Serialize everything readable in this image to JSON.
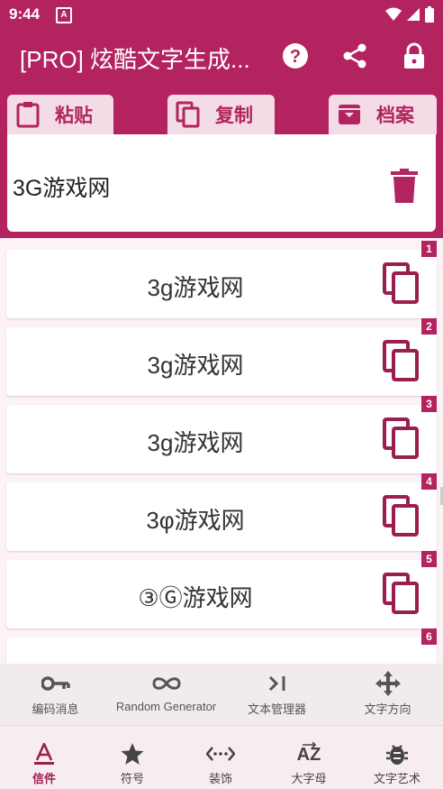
{
  "status": {
    "time": "9:44",
    "notif_letter": "A"
  },
  "appbar": {
    "title": "[PRO] 炫酷文字生成..."
  },
  "toolbar": {
    "paste_label": "粘贴",
    "copy_label": "复制",
    "archive_label": "档案"
  },
  "editor": {
    "text": "3G游戏网"
  },
  "results": [
    {
      "text": "3g游戏网",
      "num": "1"
    },
    {
      "text": "3g游戏网",
      "num": "2"
    },
    {
      "text": "3g游戏网",
      "num": "3"
    },
    {
      "text": "3φ游戏网",
      "num": "4"
    },
    {
      "text": "③Ⓖ游戏网",
      "num": "5"
    },
    {
      "text": "",
      "num": "6"
    }
  ],
  "subnav": {
    "items": [
      "编码消息",
      "Random Generator",
      "文本管理器",
      "文字方向"
    ]
  },
  "bottomnav": {
    "items": [
      "信件",
      "符号",
      "装饰",
      "大字母",
      "文字艺术"
    ]
  },
  "colors": {
    "primary": "#b3235f",
    "accent": "#9a1f4f"
  }
}
